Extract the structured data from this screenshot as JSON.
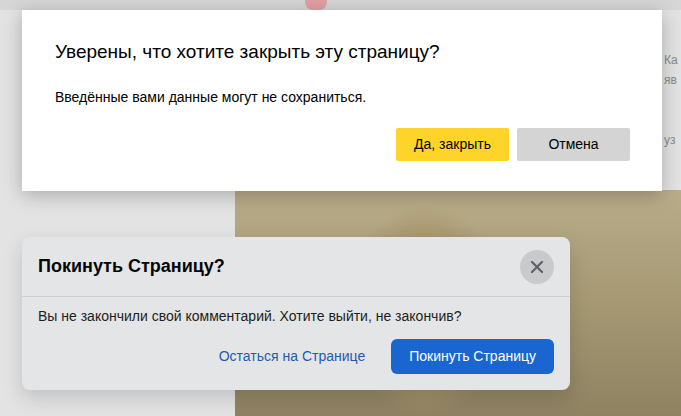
{
  "background": {
    "side_texts": [
      "Ка",
      "яв",
      "уз"
    ]
  },
  "close_dialog": {
    "title": "Уверены, что хотите закрыть эту страницу?",
    "message": "Введённые вами данные могут не сохраниться.",
    "buttons": [
      {
        "label": "Да, закрыть",
        "primary": true
      },
      {
        "label": "Отмена",
        "primary": false
      }
    ]
  },
  "leave_dialog": {
    "title": "Покинуть Страницу?",
    "message": "Вы не закончили свой комментарий. Хотите выйти, не закончив?",
    "buttons": [
      {
        "label": "Остаться на Странице",
        "primary": false
      },
      {
        "label": "Покинуть Страницу",
        "primary": true
      }
    ]
  }
}
